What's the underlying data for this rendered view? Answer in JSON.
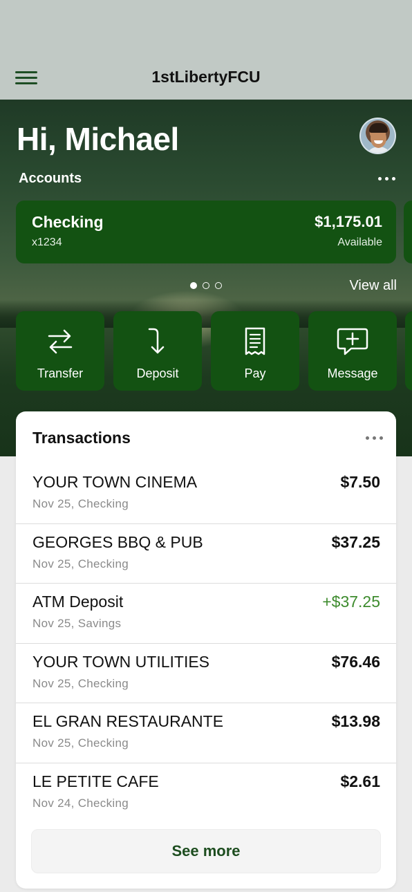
{
  "app": {
    "title": "1stLibertyFCU"
  },
  "header": {
    "greeting": "Hi, Michael"
  },
  "accounts": {
    "label": "Accounts",
    "view_all": "View all",
    "current": {
      "name": "Checking",
      "number": "x1234",
      "balance": "$1,175.01",
      "balance_label": "Available"
    },
    "page_count": 3,
    "active_page": 1
  },
  "actions": [
    {
      "label": "Transfer",
      "icon": "transfer-icon"
    },
    {
      "label": "Deposit",
      "icon": "deposit-icon"
    },
    {
      "label": "Pay",
      "icon": "receipt-icon"
    },
    {
      "label": "Message",
      "icon": "message-add-icon"
    }
  ],
  "transactions": {
    "title": "Transactions",
    "see_more": "See more",
    "items": [
      {
        "merchant": "YOUR TOWN CINEMA",
        "meta": "Nov 25, Checking",
        "amount": "$7.50",
        "credit": false
      },
      {
        "merchant": "GEORGES BBQ & PUB",
        "meta": "Nov 25, Checking",
        "amount": "$37.25",
        "credit": false
      },
      {
        "merchant": "ATM Deposit",
        "meta": "Nov 25, Savings",
        "amount": "+$37.25",
        "credit": true
      },
      {
        "merchant": "YOUR TOWN UTILITIES",
        "meta": "Nov 25, Checking",
        "amount": "$76.46",
        "credit": false
      },
      {
        "merchant": "EL GRAN RESTAURANTE",
        "meta": "Nov 25, Checking",
        "amount": "$13.98",
        "credit": false
      },
      {
        "merchant": "LE PETITE CAFE",
        "meta": "Nov 24, Checking",
        "amount": "$2.61",
        "credit": false
      }
    ]
  },
  "colors": {
    "brand_green": "#135212",
    "credit_green": "#3d8b2d",
    "header_bg": "#c1c9c5"
  }
}
